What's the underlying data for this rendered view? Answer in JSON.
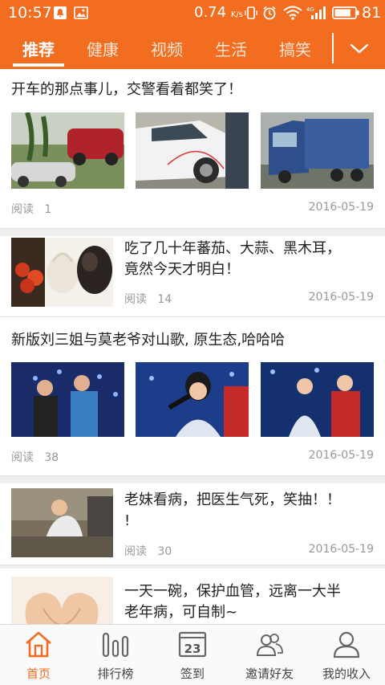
{
  "status_bar": {
    "time": "10:57",
    "net_speed": "0.74",
    "net_unit": "K/s",
    "battery": "81",
    "icons": [
      "notification-icon",
      "image-icon",
      "vibrate-icon",
      "alarm-icon",
      "wifi-icon",
      "signal-4g-icon",
      "battery-icon"
    ]
  },
  "tabs": [
    {
      "label": "推荐",
      "active": true
    },
    {
      "label": "健康",
      "active": false
    },
    {
      "label": "视频",
      "active": false
    },
    {
      "label": "生活",
      "active": false
    },
    {
      "label": "搞笑",
      "active": false
    }
  ],
  "articles": [
    {
      "title": "开车的那点事儿，交警看着都笑了！",
      "read_label": "阅读",
      "read_count": "1",
      "date": "2016-05-19"
    },
    {
      "title_line1": "吃了几十年蕃茄、大蒜、黑木耳，",
      "title_line2": "竟然今天才明白！",
      "read_label": "阅读",
      "read_count": "14",
      "date": "2016-05-19"
    },
    {
      "title": "新版刘三姐与莫老爷对山歌, 原生态,哈哈哈",
      "read_label": "阅读",
      "read_count": "38",
      "date": "2016-05-19"
    },
    {
      "title_line1": "老妹看病，把医生气死，笑抽！！",
      "title_line2": "!",
      "read_label": "阅读",
      "read_count": "30",
      "date": "2016-05-19"
    },
    {
      "title_line1": "一天一碗，保护血管，远离一大半",
      "title_line2": "老年病，可自制~"
    }
  ],
  "bottom_nav": [
    {
      "label": "首页",
      "icon": "home-icon",
      "active": true
    },
    {
      "label": "排行榜",
      "icon": "ranking-icon",
      "active": false
    },
    {
      "label": "签到",
      "icon": "calendar-icon",
      "active": false,
      "day": "23"
    },
    {
      "label": "邀请好友",
      "icon": "invite-friends-icon",
      "active": false
    },
    {
      "label": "我的收入",
      "icon": "profile-icon",
      "active": false
    }
  ],
  "colors": {
    "accent": "#f26d1f",
    "meta": "#999999",
    "separator": "#efefef"
  }
}
